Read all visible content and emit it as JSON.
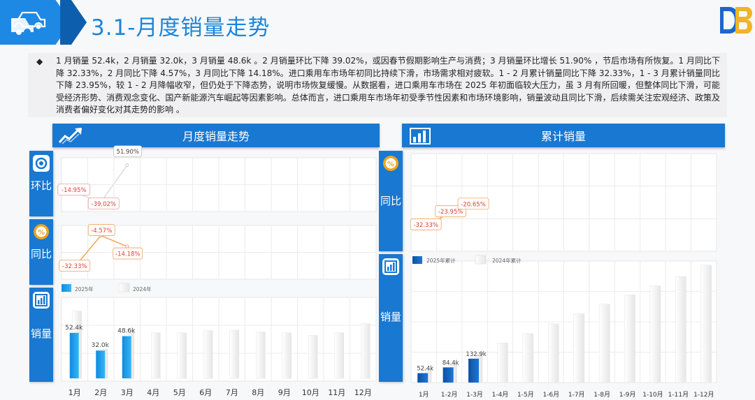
{
  "page_title": "3.1-月度销量走势",
  "bullet": "◆",
  "summary": "1 月销量 52.4k，2 月销量 32.0k，3 月销量 48.6k 。2 月销量环比下降 39.02%，或因春节假期影响生产与消费；3 月销量环比增长 51.90% ，节后市场有所恢复。1 月同比下降 32.33%，2 月同比下降 4.57%，3 月同比下降 14.18%。进口乘用车市场年初同比持续下滑，市场需求相对疲软。1 - 2 月累计销量同比下降 32.33%，1 - 3 月累计销量同比下降 23.95%，较 1 - 2 月降幅收窄，但仍处于下降态势，说明市场恢复缓慢。从数据看，进口乘用车市场在 2025 年初面临较大压力，虽 3 月有所回暖，但整体同比下滑，可能受经济形势、消费观念变化、国产新能源汽车崛起等因素影响。总体而言，进口乘用车市场年初受季节性因素和市场环境影响，销量波动且同比下滑，后续需关注宏观经济、政策及消费者偏好变化对其走势的影响 。",
  "left_panel": {
    "banner": "月度销量走势",
    "side_mom": "环比",
    "side_yoy": "同比",
    "side_sales": "销量",
    "legend_2025": "2025年",
    "legend_2024": "2024年"
  },
  "right_panel": {
    "banner": "累计销量",
    "side_yoy": "同比",
    "side_sales": "销量",
    "legend_2025": "2025年累计",
    "legend_2024": "2024年累计"
  },
  "colors": {
    "primary": "#1878d2",
    "bar2025": "#1aa3f0",
    "cum2025": "#1565c0",
    "bar2024": "#f2f2f2",
    "neg": "#e53935",
    "orange": "#f5a35c"
  },
  "chart_data": [
    {
      "type": "line",
      "name": "mom",
      "categories": [
        "1月",
        "2月",
        "3月",
        "4月",
        "5月",
        "6月",
        "7月",
        "8月",
        "9月",
        "10月",
        "11月",
        "12月"
      ],
      "values": [
        -14.95,
        -39.02,
        51.9,
        null,
        null,
        null,
        null,
        null,
        null,
        null,
        null,
        null
      ],
      "labels": [
        "-14.95%",
        "-39.02%",
        "51.90%"
      ],
      "ylim": [
        -50,
        60
      ]
    },
    {
      "type": "line",
      "name": "yoy",
      "categories": [
        "1月",
        "2月",
        "3月",
        "4月",
        "5月",
        "6月",
        "7月",
        "8月",
        "9月",
        "10月",
        "11月",
        "12月"
      ],
      "values": [
        -32.33,
        -4.57,
        -14.18,
        null,
        null,
        null,
        null,
        null,
        null,
        null,
        null,
        null
      ],
      "labels": [
        "-32.33%",
        "-4.57%",
        "-14.18%"
      ],
      "ylim": [
        -40,
        0
      ]
    },
    {
      "type": "bar",
      "name": "monthly_sales",
      "categories": [
        "1月",
        "2月",
        "3月",
        "4月",
        "5月",
        "6月",
        "7月",
        "8月",
        "9月",
        "10月",
        "11月",
        "12月"
      ],
      "series": [
        {
          "name": "2025年",
          "values": [
            52.4,
            32.0,
            48.6,
            null,
            null,
            null,
            null,
            null,
            null,
            null,
            null,
            null
          ],
          "labels": [
            "52.4k",
            "32.0k",
            "48.6k"
          ]
        },
        {
          "name": "2024年",
          "values": [
            77.4,
            33.5,
            56.6,
            52.5,
            52.5,
            55.0,
            55.5,
            53.5,
            52.5,
            49.5,
            52.5,
            63.0
          ]
        }
      ],
      "ylim": [
        0,
        90
      ]
    },
    {
      "type": "line",
      "name": "cum_yoy",
      "categories": [
        "1月",
        "1-2月",
        "1-3月",
        "1-4月",
        "1-5月",
        "1-6月",
        "1-7月",
        "1-8月",
        "1-9月",
        "1-10月",
        "1-11月",
        "1-12月"
      ],
      "values": [
        -32.33,
        -23.95,
        -20.65,
        null,
        null,
        null,
        null,
        null,
        null,
        null,
        null,
        null
      ],
      "labels": [
        "-32.33%",
        "-23.95%",
        "-20.65%"
      ],
      "ylim": [
        -40,
        0
      ]
    },
    {
      "type": "bar",
      "name": "cumulative_sales",
      "categories": [
        "1月",
        "1-2月",
        "1-3月",
        "1-4月",
        "1-5月",
        "1-6月",
        "1-7月",
        "1-8月",
        "1-9月",
        "1-10月",
        "1-11月",
        "1-12月"
      ],
      "series": [
        {
          "name": "2025年累计",
          "values": [
            52.4,
            84.4,
            132.9,
            null,
            null,
            null,
            null,
            null,
            null,
            null,
            null,
            null
          ],
          "labels": [
            "52.4k",
            "84.4k",
            "132.9k"
          ]
        },
        {
          "name": "2024年累计",
          "values": [
            77.4,
            110.9,
            167.5,
            220.0,
            272.5,
            327.5,
            383.0,
            436.5,
            489.0,
            538.5,
            591.0,
            654.0
          ]
        }
      ],
      "ylim": [
        0,
        700
      ]
    }
  ]
}
